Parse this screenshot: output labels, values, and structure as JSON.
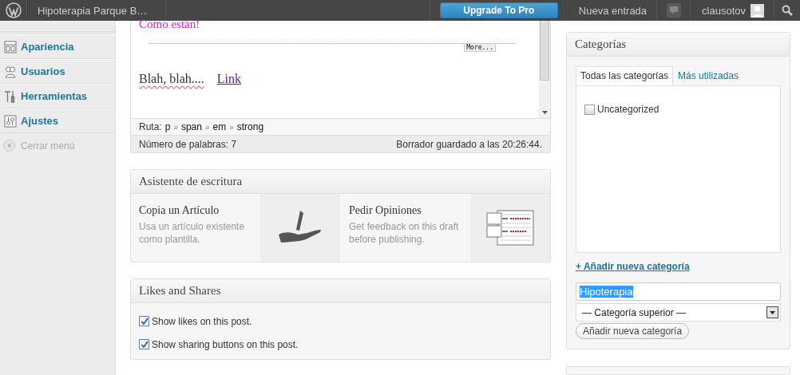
{
  "top_bar": {
    "site_title": "Hipoterapia Parque B…",
    "upgrade_button": "Upgrade To Pro",
    "new_post": "Nueva entrada",
    "user": "clausotov"
  },
  "sidebar": {
    "items": [
      {
        "label": "Apariencia",
        "kind": "appearance"
      },
      {
        "label": "Usuarios",
        "kind": "users"
      },
      {
        "label": "Herramientas",
        "kind": "tools"
      },
      {
        "label": "Ajustes",
        "kind": "settings"
      }
    ],
    "collapse": "Cerrar menú"
  },
  "editor": {
    "heading": "Como están!",
    "more_tag": "More...",
    "paragraph": "Blah, blah....",
    "link": "Link",
    "path_label": "Ruta:",
    "path": [
      "p",
      "span",
      "em",
      "strong"
    ],
    "separator": "»",
    "word_count": "Número de palabras: 7",
    "draft_saved": "Borrador guardado a las 20:26:44."
  },
  "writing_helper": {
    "title": "Asistente de escritura",
    "cards": [
      {
        "title": "Copia un Artículo",
        "description": "Usa un artículo existente como plantilla.",
        "kind": "copy"
      },
      {
        "title": "Pedir Opiniones",
        "description": "Get feedback on this draft before publishing.",
        "kind": "feedback"
      }
    ]
  },
  "likes": {
    "title": "Likes and Shares",
    "options": [
      {
        "label": "Show likes on this post.",
        "checked": true
      },
      {
        "label": "Show sharing buttons on this post.",
        "checked": true
      }
    ]
  },
  "categories": {
    "title": "Categorías",
    "tabs": [
      {
        "label": "Todas las categorías",
        "selected": true
      },
      {
        "label": "Más utilizadas",
        "selected": false
      }
    ],
    "items": [
      {
        "label": "Uncategorized",
        "checked": false
      }
    ],
    "add_link": "+ Añadir nueva categoría",
    "new_category_value": "Hipoterapia",
    "parent_select": "— Categoría superior —",
    "add_button": "Añadir nueva categoría"
  }
}
